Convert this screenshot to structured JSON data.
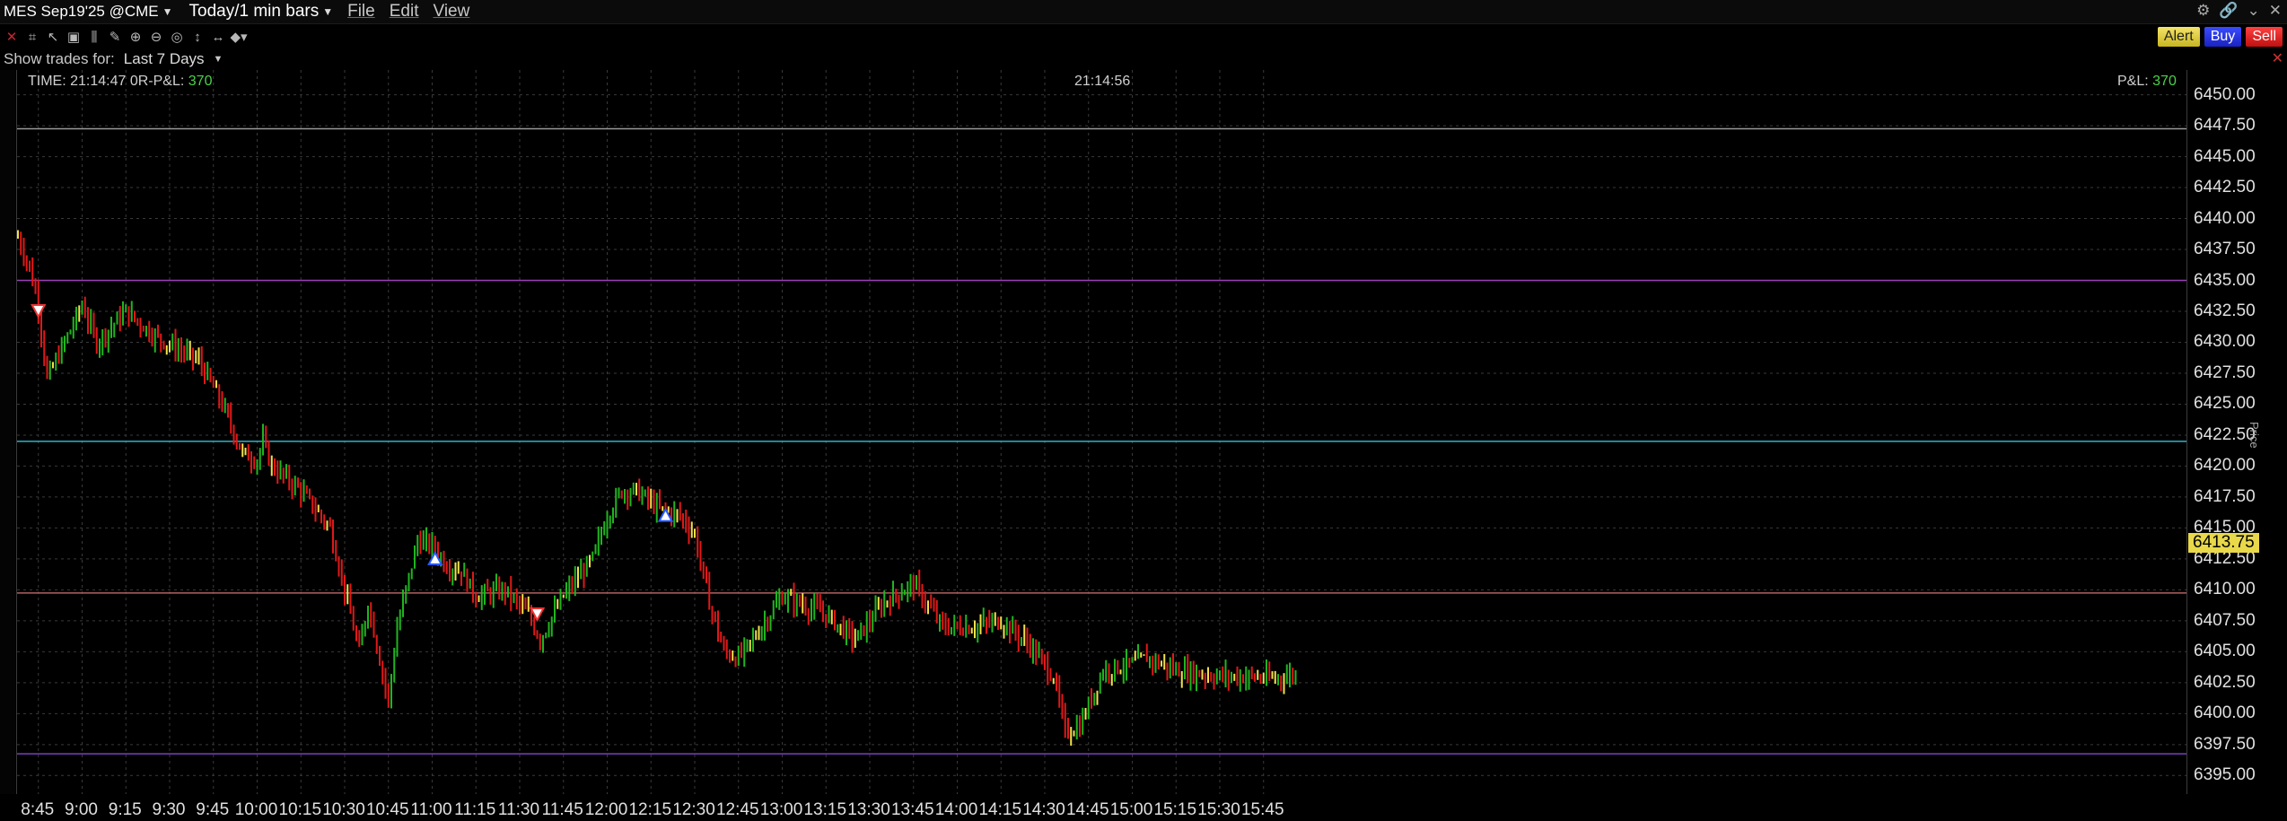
{
  "window": {
    "symbol": "MES Sep19'25 @CME",
    "bar_setting": "Today/1 min bars",
    "menus": [
      "File",
      "Edit",
      "View"
    ],
    "window_icons": [
      "gear-icon",
      "link-icon",
      "chevron-down-icon",
      "close-icon"
    ]
  },
  "toolbar": {
    "tools": [
      "close-red-icon",
      "crosshair-icon",
      "cursor-icon",
      "chart-icon",
      "bars-icon",
      "pencil-icon",
      "zoom-in-icon",
      "zoom-out-icon",
      "target-icon",
      "pan-vertical-icon",
      "pan-horizontal-icon",
      "shapes-icon"
    ],
    "actions": {
      "alert": "Alert",
      "buy": "Buy",
      "sell": "Sell"
    }
  },
  "show_trades": {
    "label": "Show trades for:",
    "value": "Last 7 Days"
  },
  "info": {
    "time_label": "TIME: 21:14:47",
    "flag": "0",
    "rpl_label": "R-P&L:",
    "rpl_value": "370",
    "center_time": "21:14:56",
    "pl_label": "P&L:",
    "pl_value": "370"
  },
  "current_price": "6413.75",
  "axis_title": "Price",
  "chart_data": {
    "type": "ohlc",
    "ylim": [
      6393.5,
      6452.0
    ],
    "yticks": [
      "6450.00",
      "6447.50",
      "6445.00",
      "6442.50",
      "6440.00",
      "6437.50",
      "6435.00",
      "6432.50",
      "6430.00",
      "6427.50",
      "6425.00",
      "6422.50",
      "6420.00",
      "6417.50",
      "6415.00",
      "6412.50",
      "6410.00",
      "6407.50",
      "6405.00",
      "6402.50",
      "6400.00",
      "6397.50",
      "6395.00"
    ],
    "xticks": [
      "8:45",
      "9:00",
      "9:15",
      "9:30",
      "9:45",
      "10:00",
      "10:15",
      "10:30",
      "10:45",
      "11:00",
      "11:15",
      "11:30",
      "11:45",
      "12:00",
      "12:15",
      "12:30",
      "12:45",
      "13:00",
      "13:15",
      "13:30",
      "13:45",
      "14:00",
      "14:15",
      "14:30",
      "14:45",
      "15:00",
      "15:15",
      "15:30",
      "15:45"
    ],
    "start_time": "8:38",
    "horizontal_lines": [
      {
        "price": 6447.25,
        "color": "#9a9a9a"
      },
      {
        "price": 6435.0,
        "color": "#9b3fb5"
      },
      {
        "price": 6422.0,
        "color": "#2fb3c8"
      },
      {
        "price": 6409.75,
        "color": "#b06060"
      },
      {
        "price": 6396.75,
        "color": "#7a3fbf"
      }
    ],
    "anchors": [
      [
        "8:38",
        6438.5
      ],
      [
        "8:42",
        6436.0
      ],
      [
        "8:45",
        6433.0
      ],
      [
        "8:48",
        6427.0
      ],
      [
        "8:53",
        6429.5
      ],
      [
        "9:00",
        6433.0
      ],
      [
        "9:05",
        6430.0
      ],
      [
        "9:15",
        6432.5
      ],
      [
        "9:25",
        6430.5
      ],
      [
        "9:40",
        6428.5
      ],
      [
        "9:48",
        6425.0
      ],
      [
        "9:55",
        6421.0
      ],
      [
        "10:00",
        6420.5
      ],
      [
        "10:02",
        6422.0
      ],
      [
        "10:05",
        6420.0
      ],
      [
        "10:15",
        6418.0
      ],
      [
        "10:25",
        6415.0
      ],
      [
        "10:30",
        6410.0
      ],
      [
        "10:35",
        6405.0
      ],
      [
        "10:38",
        6409.0
      ],
      [
        "10:45",
        6401.0
      ],
      [
        "10:48",
        6407.0
      ],
      [
        "10:55",
        6414.0
      ],
      [
        "11:00",
        6413.5
      ],
      [
        "11:05",
        6412.0
      ],
      [
        "11:10",
        6411.5
      ],
      [
        "11:15",
        6409.5
      ],
      [
        "11:25",
        6410.0
      ],
      [
        "11:33",
        6408.0
      ],
      [
        "11:37",
        6406.0
      ],
      [
        "11:45",
        6409.5
      ],
      [
        "11:55",
        6412.5
      ],
      [
        "12:00",
        6416.0
      ],
      [
        "12:05",
        6418.0
      ],
      [
        "12:10",
        6418.0
      ],
      [
        "12:18",
        6416.5
      ],
      [
        "12:25",
        6416.0
      ],
      [
        "12:30",
        6414.5
      ],
      [
        "12:35",
        6409.0
      ],
      [
        "12:40",
        6405.0
      ],
      [
        "12:45",
        6404.5
      ],
      [
        "12:50",
        6406.0
      ],
      [
        "13:00",
        6409.5
      ],
      [
        "13:10",
        6408.5
      ],
      [
        "13:15",
        6408.0
      ],
      [
        "13:25",
        6406.0
      ],
      [
        "13:35",
        6409.0
      ],
      [
        "13:45",
        6410.5
      ],
      [
        "13:55",
        6407.0
      ],
      [
        "14:05",
        6407.0
      ],
      [
        "14:15",
        6407.5
      ],
      [
        "14:25",
        6405.5
      ],
      [
        "14:33",
        6403.0
      ],
      [
        "14:37",
        6398.5
      ],
      [
        "14:42",
        6399.0
      ],
      [
        "14:50",
        6403.5
      ],
      [
        "15:00",
        6404.0
      ],
      [
        "15:05",
        6404.5
      ],
      [
        "15:15",
        6403.5
      ],
      [
        "15:30",
        6403.0
      ],
      [
        "15:40",
        6403.0
      ],
      [
        "15:48",
        6402.8
      ],
      [
        "15:56",
        6403.2
      ]
    ],
    "trade_markers": [
      {
        "time": "8:45",
        "price": 6432.5,
        "side": "sell"
      },
      {
        "time": "11:01",
        "price": 6412.5,
        "side": "buy"
      },
      {
        "time": "11:36",
        "price": 6408.0,
        "side": "sell"
      },
      {
        "time": "12:20",
        "price": 6416.0,
        "side": "buy"
      }
    ]
  }
}
